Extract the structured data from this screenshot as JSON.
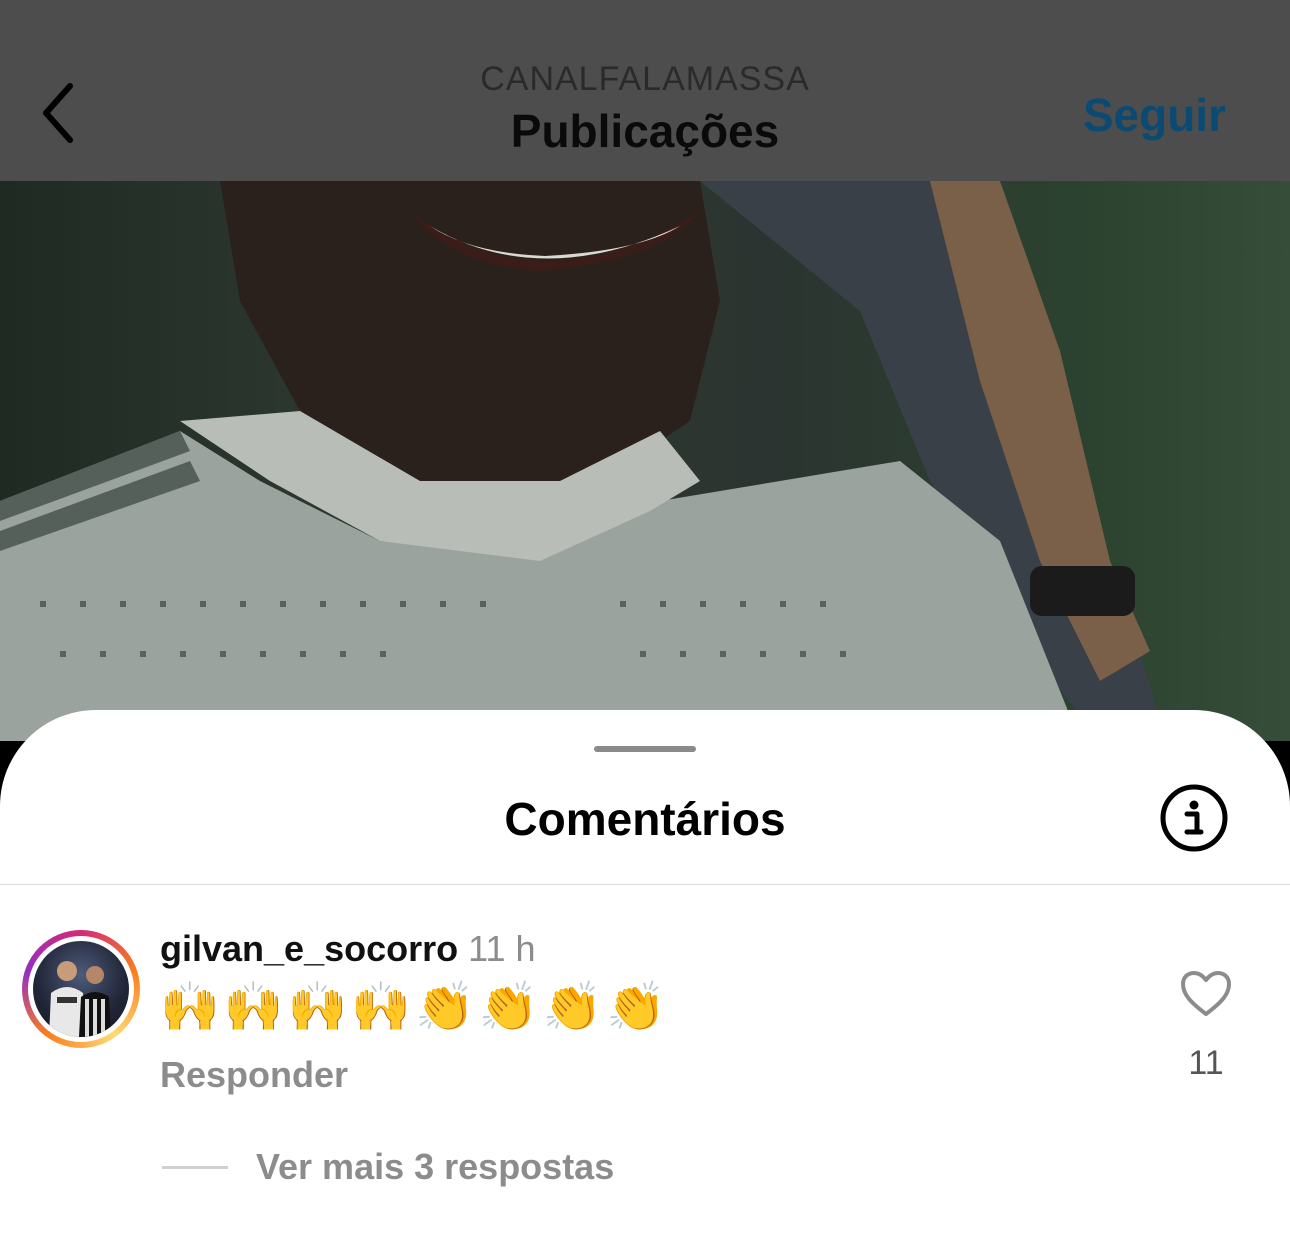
{
  "header": {
    "username": "CANALFALAMASSA",
    "title": "Publicações",
    "follow_label": "Seguir",
    "back_icon": "chevron-left-icon"
  },
  "comments_sheet": {
    "title": "Comentários",
    "info_icon": "info-icon",
    "comment": {
      "username": "gilvan_e_socorro",
      "time": "11 h",
      "text": "🙌🙌🙌🙌👏👏👏👏",
      "reply_label": "Responder",
      "like_icon": "heart-icon",
      "like_count": "11",
      "more_replies": "Ver mais 3 respostas"
    }
  },
  "colors": {
    "follow": "#0b4a73",
    "header_bg": "#4d4d4d",
    "muted_text": "#8c8c8c"
  }
}
